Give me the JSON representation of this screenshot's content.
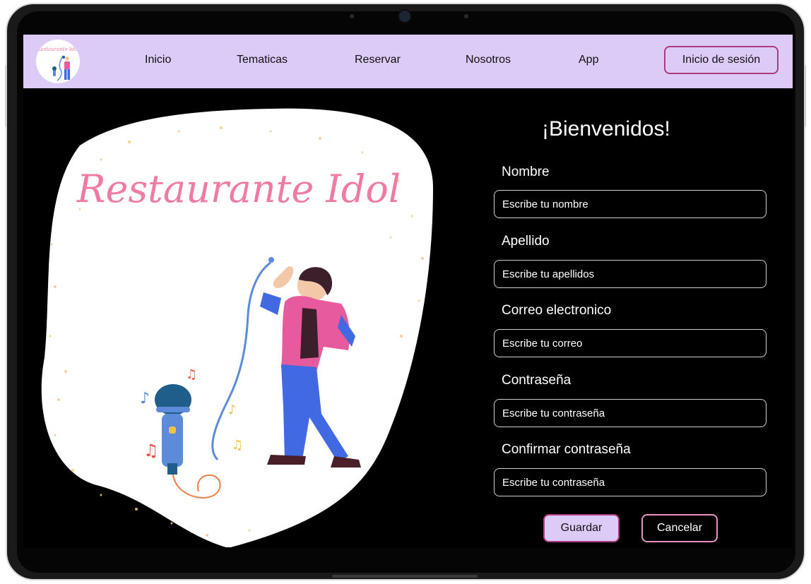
{
  "nav": {
    "logo_text": "Restaurante Idol",
    "links": [
      "Inicio",
      "Tematicas",
      "Reservar",
      "Nosotros",
      "App"
    ],
    "login_label": "Inicio de sesión"
  },
  "hero": {
    "brand_text": "Restaurante Idol"
  },
  "form": {
    "title": "¡Bienvenidos!",
    "fields": [
      {
        "label": "Nombre",
        "placeholder": "Escribe tu nombre"
      },
      {
        "label": "Apellido",
        "placeholder": "Escribe tu apellidos"
      },
      {
        "label": "Correo electronico",
        "placeholder": "Escribe tu correo"
      },
      {
        "label": "Contraseña",
        "placeholder": "Escribe tu contraseña"
      },
      {
        "label": "Confirmar contraseña",
        "placeholder": "Escribe tu contraseña"
      }
    ],
    "save_label": "Guardar",
    "cancel_label": "Cancelar"
  },
  "colors": {
    "navbar": "#dccbf7",
    "accent_border": "#b03a80",
    "brand_pink": "#f07aa6",
    "background": "#000000"
  }
}
